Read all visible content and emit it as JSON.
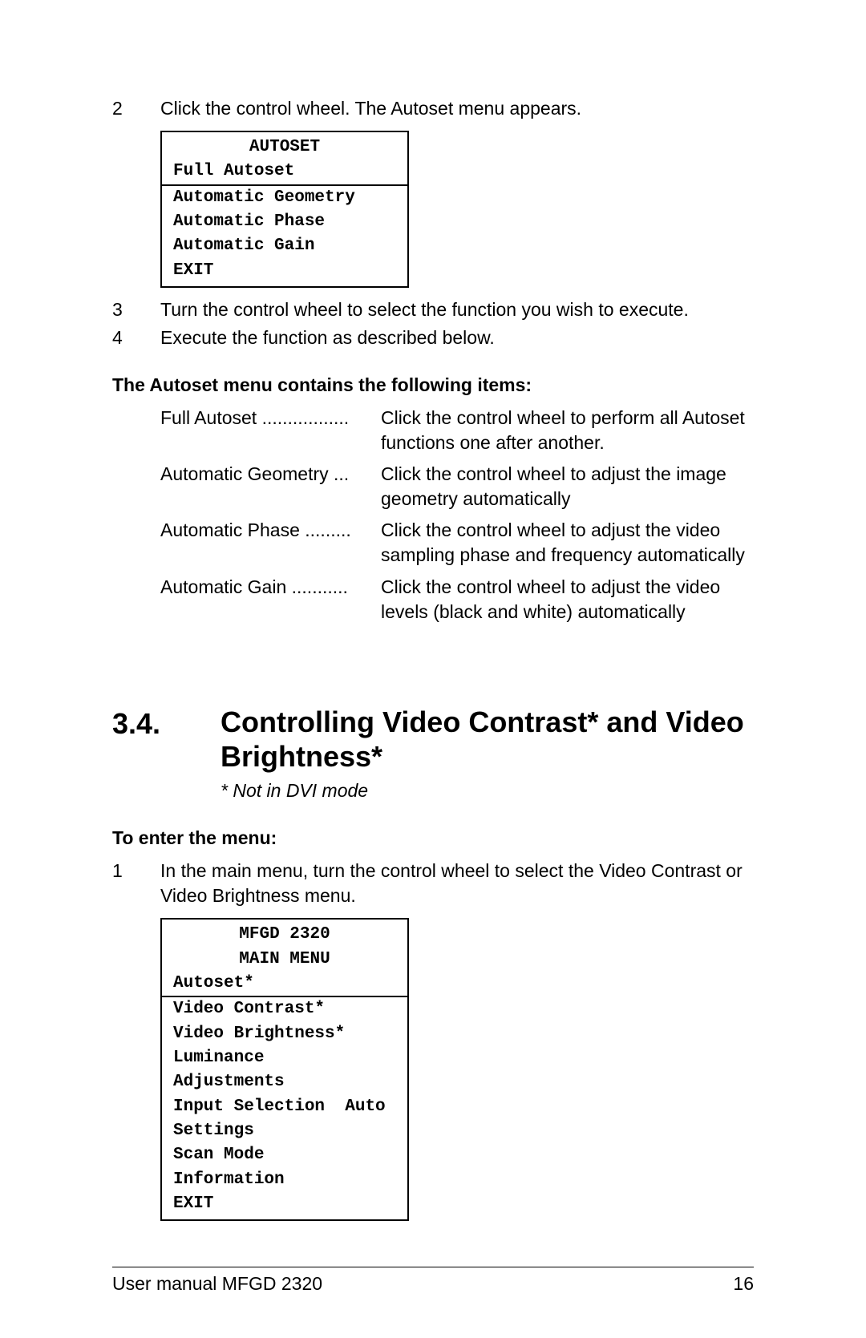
{
  "steps_a": {
    "s2": {
      "num": "2",
      "text": "Click the control wheel. The Autoset menu appears."
    },
    "s3": {
      "num": "3",
      "text": "Turn the control wheel to select the function you wish to execute."
    },
    "s4": {
      "num": "4",
      "text": "Execute the function as described below."
    }
  },
  "autoset_menu": {
    "title": "AUTOSET",
    "items": [
      "Full Autoset",
      "Automatic Geometry",
      "Automatic Phase",
      "Automatic Gain",
      "EXIT"
    ]
  },
  "subheading1": "The Autoset menu contains the following items:",
  "defs": [
    {
      "term": "Full Autoset .................",
      "desc": "Click the control wheel to perform all Autoset functions one after another."
    },
    {
      "term": "Automatic Geometry ...",
      "desc": "Click the control wheel to  adjust the image geometry automatically"
    },
    {
      "term": "Automatic Phase .........",
      "desc": "Click the control wheel to adjust the video sampling phase and frequency automatically"
    },
    {
      "term": "Automatic Gain ...........",
      "desc": "Click the control wheel to adjust the video levels (black and white) automatically"
    }
  ],
  "section": {
    "num": "3.4.",
    "title": "Controlling Video Contrast* and Video Brightness*",
    "note": "* Not in DVI mode"
  },
  "subheading2": "To enter the menu:",
  "steps_b": {
    "s1": {
      "num": "1",
      "text": "In the main menu, turn the control wheel to select the Video Contrast or Video Brightness menu."
    }
  },
  "main_menu": {
    "line1": "MFGD 2320",
    "line2": "MAIN MENU",
    "items": [
      "Autoset*",
      "Video Contrast*",
      "Video Brightness*",
      "Luminance",
      "Adjustments",
      "Input Selection  Auto",
      "Settings",
      "Scan Mode",
      "Information",
      "EXIT"
    ]
  },
  "footer": {
    "left": "User manual MFGD 2320",
    "right": "16"
  }
}
